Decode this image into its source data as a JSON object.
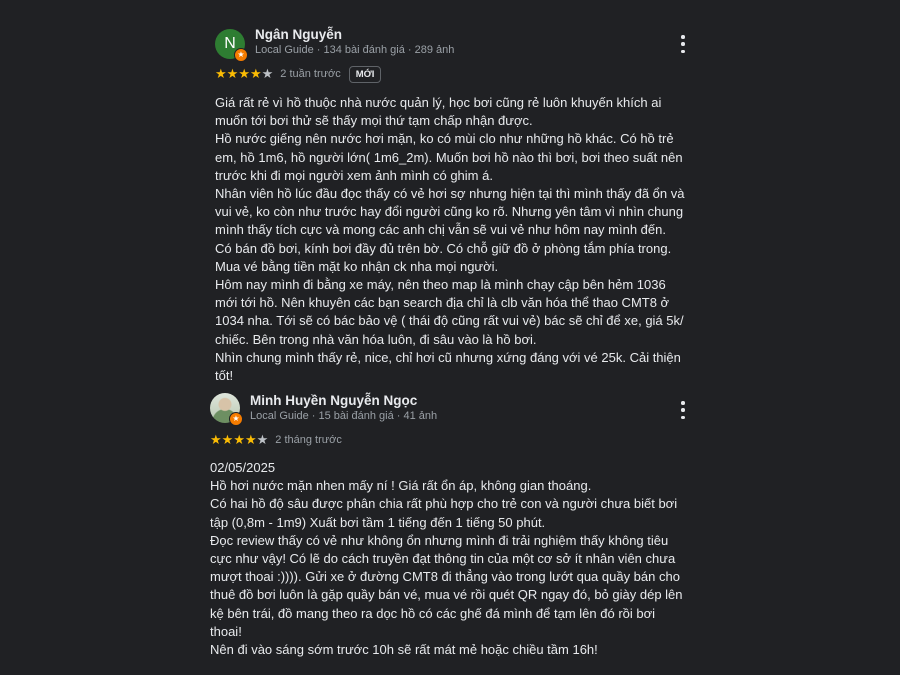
{
  "reviews": [
    {
      "avatar_letter": "N",
      "avatar_color": "#2e7d32",
      "author": "Ngân Nguyễn",
      "meta": "Local Guide · 134 bài đánh giá · 289 ảnh",
      "rating": 4,
      "time_ago": "2 tuần trước",
      "badge": "MỚI",
      "paragraphs": [
        "Giá rất rẻ vì hồ thuộc nhà nước quản lý, học bơi cũng rẻ luôn khuyến khích ai muốn tới bơi thử sẽ thấy mọi thứ tạm chấp nhận được.",
        "Hồ nước giếng nên nước hơi mặn, ko có mùi clo như những hồ khác. Có hồ trẻ em, hồ 1m6, hồ người lớn( 1m6_2m). Muốn bơi hồ nào thì bơi, bơi theo suất nên trước khi đi mọi người xem ảnh mình có ghim á.",
        "Nhân viên hồ lúc đầu đọc thấy có vẻ hơi sợ nhưng hiện tại thì mình thấy đã ổn và vui vẻ, ko còn như trước hay đổi người cũng ko rõ. Nhưng yên tâm vì nhìn chung mình thấy tích cực và mong các anh chị vẫn sẽ vui vẻ như hôm nay mình đến.",
        "Có bán đồ bơi, kính bơi đầy đủ trên bờ. Có chỗ giữ đồ ở phòng tắm phía trong. Mua vé bằng tiền mặt ko nhận ck nha mọi người.",
        "Hôm nay mình đi bằng xe máy, nên theo map là mình chạy cập bên hẻm 1036 mới tới hồ. Nên khuyên các bạn search địa chỉ là clb văn hóa thể thao CMT8 ở 1034 nha. Tới sẽ có bác bảo vệ ( thái độ cũng rất vui vẻ) bác sẽ chỉ để xe, giá 5k/ chiếc. Bên trong nhà văn hóa luôn, đi sâu vào là hồ bơi.",
        "Nhìn chung mình thấy rẻ, nice, chỉ hơi cũ nhưng xứng đáng với vé 25k. Cải thiện tốt!"
      ]
    },
    {
      "author": "Minh Huyền Nguyễn Ngọc",
      "meta": "Local Guide · 15 bài đánh giá · 41 ảnh",
      "rating": 4,
      "time_ago": "2 tháng trước",
      "paragraphs": [
        "02/05/2025",
        "Hồ hơi nước mặn nhen mấy ní ! Giá rất ổn áp, không gian thoáng.",
        "Có hai hồ độ sâu được phân chia rất phù hợp cho trẻ con và người chưa biết bơi tập (0,8m - 1m9) Xuất bơi tầm 1 tiếng đến 1 tiếng 50 phút.",
        "Đọc review thấy có vẻ như không ổn nhưng mình đi trải nghiệm thấy không tiêu cực như vậy! Có lẽ do cách truyền đạt thông tin của một cơ sở ít nhân viên chưa mượt thoai :)))). Gửi xe ở đường CMT8 đi thẳng vào trong lướt qua quầy bán cho thuê đồ bơi luôn là gặp quầy bán vé, mua vé rồi quét QR ngay đó, bỏ giày dép lên kệ bên trái, đồ mang theo ra dọc hồ có các ghế đá mình để tạm lên đó rồi bơi thoai!",
        "Nên đi vào sáng sớm trước 10h sẽ rất mát mẻ hoặc chiều tầm 16h!"
      ]
    }
  ],
  "icons": {
    "star": "★",
    "local_guide_badge": "star-badge-icon",
    "more": "more-vert-icon"
  },
  "colors": {
    "background": "#202124",
    "star_on": "#fbbc04",
    "star_off": "#bdc1c6",
    "badge": "#f57c00"
  }
}
